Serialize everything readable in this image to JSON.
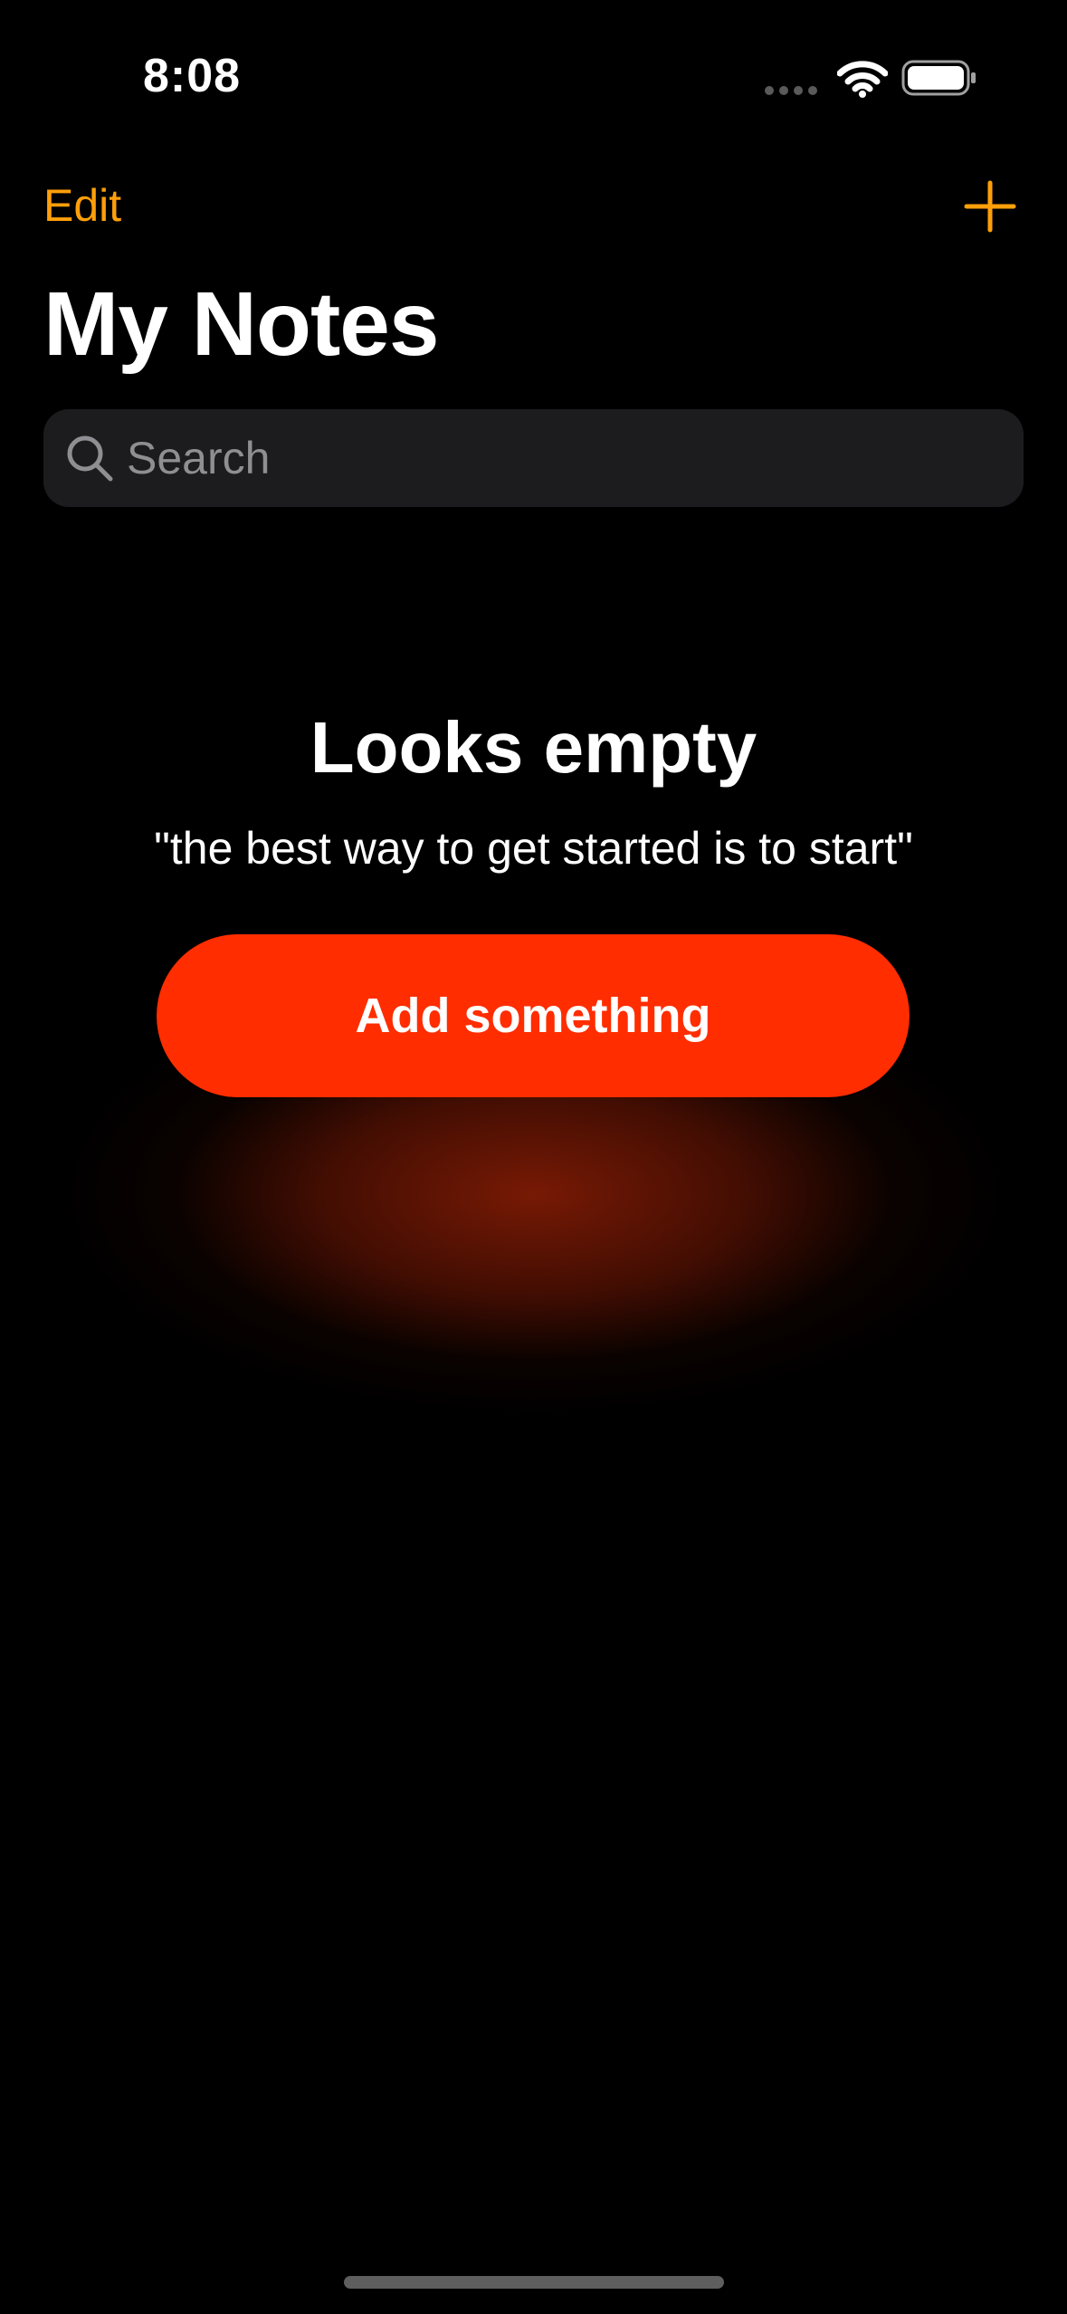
{
  "status_bar": {
    "time": "8:08",
    "icons": [
      "signal-dots-icon",
      "wifi-icon",
      "battery-icon"
    ]
  },
  "nav": {
    "edit_label": "Edit",
    "add_icon": "plus-icon"
  },
  "page_title": "My Notes",
  "search": {
    "placeholder": "Search",
    "value": "",
    "icon": "magnifying-glass-icon"
  },
  "empty_state": {
    "title": "Looks empty",
    "quote": "\"the best way to get started is to start\"",
    "button_label": "Add something"
  },
  "colors": {
    "accent": "#ff9f0a",
    "button": "#ff2d00",
    "background": "#000000",
    "search_field": "#1c1c1e",
    "placeholder": "#8e8e93"
  }
}
